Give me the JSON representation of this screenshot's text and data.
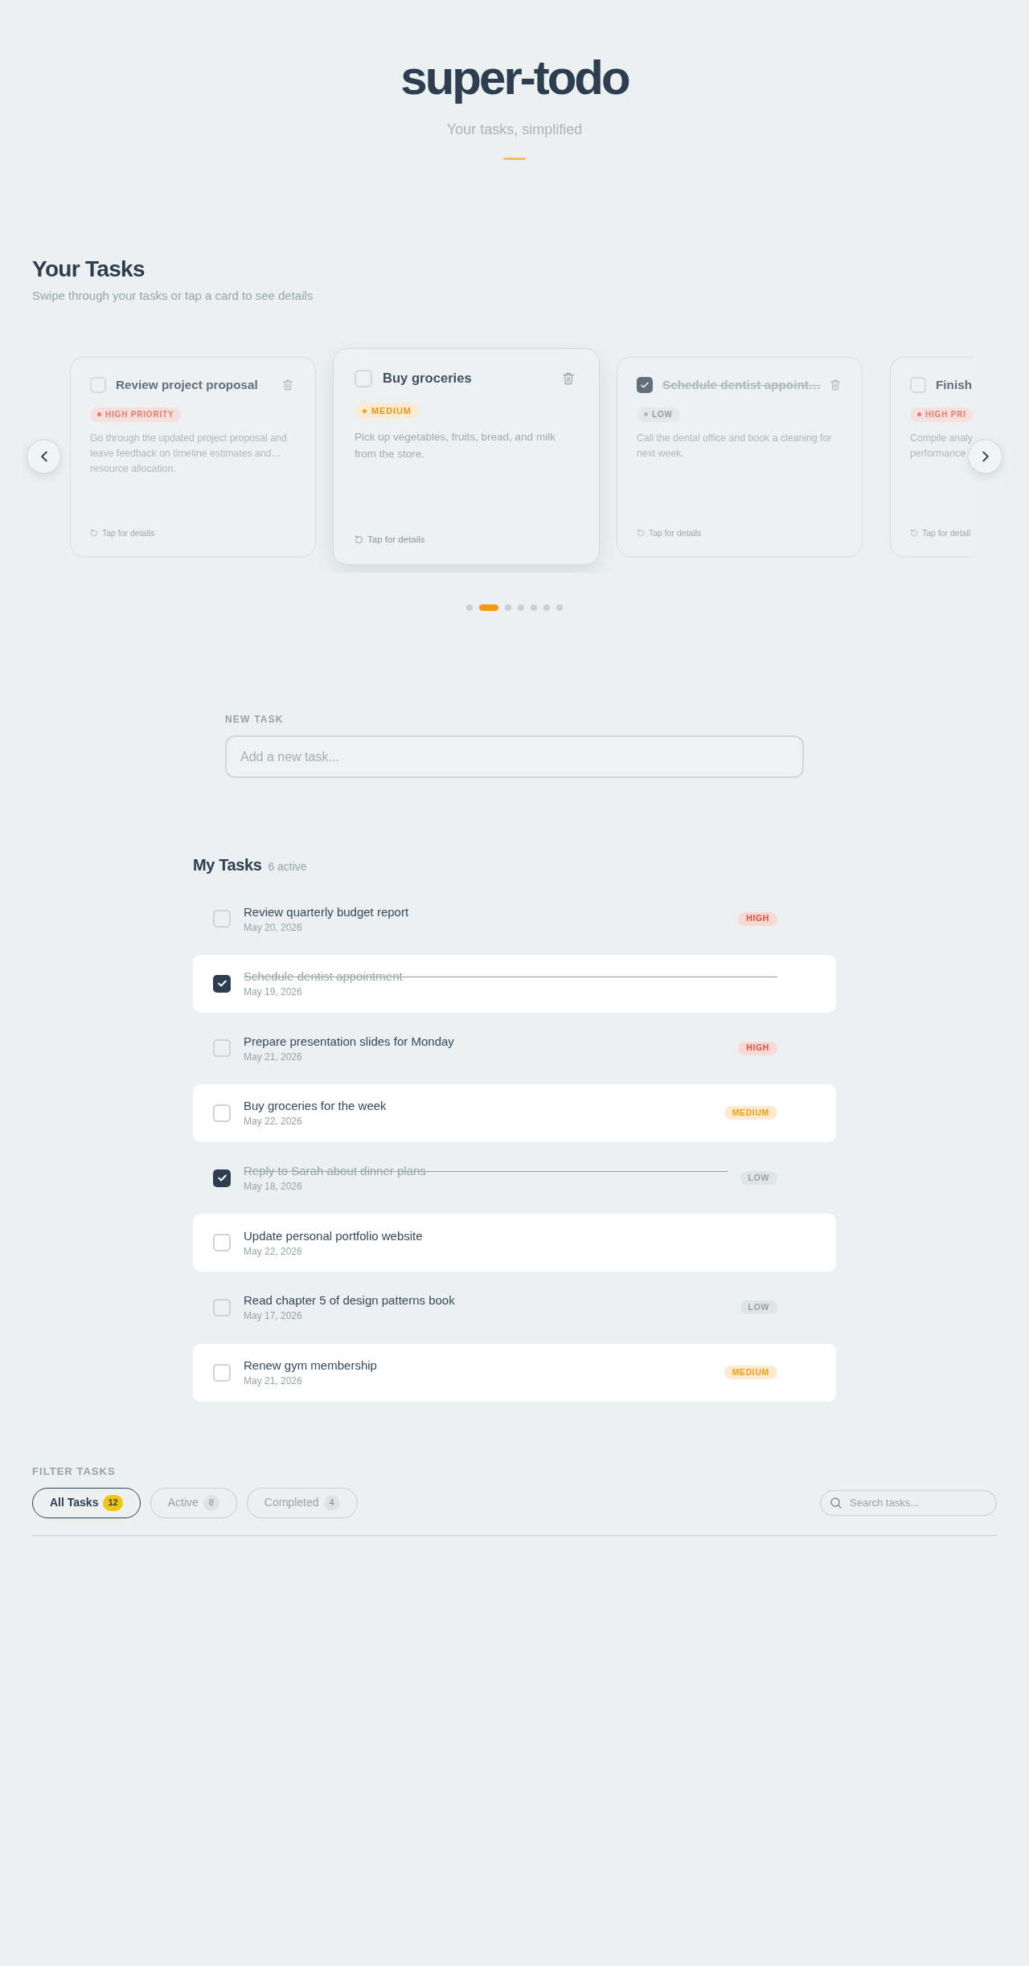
{
  "header": {
    "title": "super-todo",
    "subtitle": "Your tasks, simplified"
  },
  "carousel": {
    "title": "Your Tasks",
    "subtitle": "Swipe through your tasks or tap a card to see details",
    "cards": [
      {
        "title": "Review project proposal",
        "completed": false,
        "selected": false,
        "priority": {
          "kind": "high",
          "label": "HIGH PRIORITY"
        },
        "description_lines": [
          "Go through the updated project proposal and",
          "leave feedback on timeline estimates and…",
          "resource allocation."
        ],
        "hint": "Tap for details"
      },
      {
        "title": "Buy groceries",
        "completed": false,
        "selected": true,
        "priority": {
          "kind": "medium",
          "label": "MEDIUM"
        },
        "description_lines": [
          "Pick up vegetables, fruits, bread, and milk",
          "from the store."
        ],
        "hint": "Tap for details"
      },
      {
        "title": "Schedule dentist appoint…",
        "completed": true,
        "selected": false,
        "priority": {
          "kind": "low",
          "label": "LOW"
        },
        "description_lines": [
          "Call the dental office and book a cleaning for",
          "next week."
        ],
        "hint": "Tap for details"
      },
      {
        "title": "Finish",
        "completed": false,
        "selected": false,
        "priority": {
          "kind": "high",
          "label": "HIGH PRI"
        },
        "description_lines": [
          "Compile analy",
          "performance"
        ],
        "hint": "Tap for detail"
      }
    ],
    "dots": [
      {
        "selected": false
      },
      {
        "selected": true
      },
      {
        "selected": false
      },
      {
        "selected": false
      },
      {
        "selected": false
      },
      {
        "selected": false
      },
      {
        "selected": false
      }
    ]
  },
  "new_task": {
    "label": "NEW TASK",
    "placeholder": "Add a new task..."
  },
  "task_list": {
    "title": "My Tasks",
    "count": "6 active",
    "tasks": [
      {
        "title": "Review quarterly budget report",
        "date": "May 20, 2026",
        "completed": false,
        "priority": {
          "kind": "high",
          "label": "HIGH"
        }
      },
      {
        "title": "Schedule dentist appointment",
        "date": "May 19, 2026",
        "completed": true
      },
      {
        "title": "Prepare presentation slides for Monday",
        "date": "May 21, 2026",
        "completed": false,
        "priority": {
          "kind": "high",
          "label": "HIGH"
        }
      },
      {
        "title": "Buy groceries for the week",
        "date": "May 22, 2026",
        "completed": false,
        "priority": {
          "kind": "medium",
          "label": "MEDIUM"
        }
      },
      {
        "title": "Reply to Sarah about dinner plans",
        "date": "May 18, 2026",
        "completed": true,
        "priority": {
          "kind": "low",
          "label": "LOW"
        }
      },
      {
        "title": "Update personal portfolio website",
        "date": "May 22, 2026",
        "completed": false
      },
      {
        "title": "Read chapter 5 of design patterns book",
        "date": "May 17, 2026",
        "completed": false,
        "priority": {
          "kind": "low",
          "label": "LOW"
        }
      },
      {
        "title": "Renew gym membership",
        "date": "May 21, 2026",
        "completed": false,
        "priority": {
          "kind": "medium",
          "label": "MEDIUM"
        }
      }
    ]
  },
  "filter": {
    "label": "FILTER TASKS",
    "tabs": [
      {
        "label": "All Tasks",
        "count": "12",
        "selected": true
      },
      {
        "label": "Active",
        "count": "8",
        "selected": false
      },
      {
        "label": "Completed",
        "count": "4",
        "selected": false
      }
    ],
    "search": {
      "placeholder": "Search tasks..."
    }
  }
}
